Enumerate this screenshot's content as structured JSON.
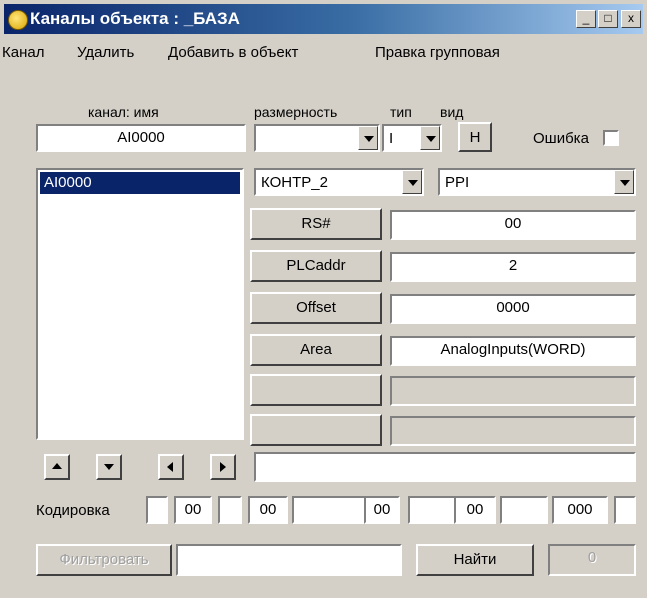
{
  "window": {
    "title": "Каналы объекта : _БАЗА",
    "minimize": "_",
    "maximize": "□",
    "close": "x"
  },
  "menu": [
    "Канал",
    "Удалить",
    "Добавить в объект",
    "Правка групповая"
  ],
  "labels": {
    "channel_name": "канал: имя",
    "dimension": "размерность",
    "type": "тип",
    "view": "вид",
    "error": "Ошибка",
    "encoding": "Кодировка"
  },
  "channel_name_value": "AI0000",
  "dimension_value": "",
  "type_value": "I",
  "view_button": "H",
  "channel_list": [
    "AI0000"
  ],
  "controller_combo": "КОНТР_2",
  "protocol_combo": "PPI",
  "params": [
    {
      "label": "RS#",
      "value": "00"
    },
    {
      "label": "PLCaddr",
      "value": "2"
    },
    {
      "label": "Offset",
      "value": "0000"
    },
    {
      "label": "Area",
      "value": "AnalogInputs(WORD)"
    },
    {
      "label": "",
      "value": ""
    },
    {
      "label": "",
      "value": ""
    }
  ],
  "bottom_field_value": "",
  "encoding_values": [
    "",
    "00",
    "",
    "00",
    "",
    "00",
    "",
    "00",
    "",
    "000",
    ""
  ],
  "filter_button": "Фильтровать",
  "filter_input": "",
  "find_button": "Найти",
  "count_value": "0"
}
